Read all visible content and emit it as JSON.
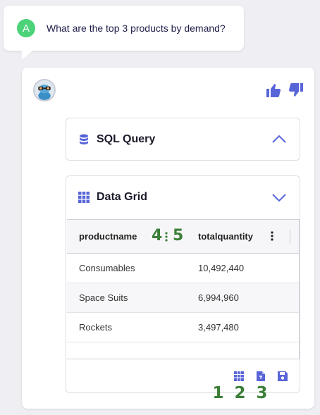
{
  "question": {
    "avatar_letter": "A",
    "text": "What are the top 3 products by demand?",
    "avatar_color": "#4cd37a"
  },
  "feedback": {
    "like_icon": "thumbs-up-icon",
    "dislike_icon": "thumbs-down-icon"
  },
  "sql_panel": {
    "title": "SQL Query",
    "state": "expanded-chevron-up"
  },
  "grid_panel": {
    "title": "Data Grid",
    "state": "chevron-down"
  },
  "grid": {
    "columns": [
      "productname",
      "totalquantity"
    ],
    "rows": [
      {
        "productname": "Consumables",
        "totalquantity": "10,492,440"
      },
      {
        "productname": "Space Suits",
        "totalquantity": "6,994,960"
      },
      {
        "productname": "Rockets",
        "totalquantity": "3,497,480"
      }
    ]
  },
  "annotations": {
    "header_left": "4",
    "header_right": "5",
    "tool_1": "1",
    "tool_2": "2",
    "tool_3": "3"
  },
  "tools": [
    "grid-view-icon",
    "export-file-icon",
    "save-icon"
  ],
  "colors": {
    "accent": "#5865d8",
    "annotation": "#3c7f38"
  }
}
